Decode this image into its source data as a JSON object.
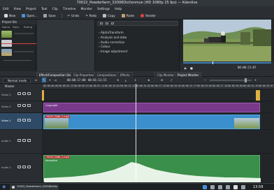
{
  "window": {
    "title": "70022_Powderfarm_32006Dictionmun (HD 1080p 25 fps) — Kdenlive"
  },
  "menu": [
    "Edit",
    "View",
    "Project",
    "Tool",
    "Clip",
    "Timeline",
    "Monitor",
    "Settings",
    "Help"
  ],
  "toolbar": {
    "new": "New",
    "open": "Open...",
    "save": "Save",
    "undo": "Undo",
    "redo": "Redo",
    "copy": "Copy",
    "paste": "Paste",
    "render": "Render"
  },
  "library": {
    "bin": "Project Bin",
    "col_name": "Name",
    "col_date": "Date",
    "col_rating": "Rating"
  },
  "effects": {
    "items": [
      "AlphaTransform",
      "Analysis and data",
      "Audio correction",
      "Colour",
      "Image adjustment"
    ]
  },
  "monitor": {
    "timecode": "00:00:21:07"
  },
  "tabs": [
    "Effect/Composition Stack",
    "Clip Properties",
    "Compositions",
    "Effects",
    "Clip Monitor",
    "Project Monitor"
  ],
  "timeline": {
    "mode": "Normal mode",
    "timecode": "00:00:17:00",
    "duration": "00:01:13:15",
    "master": "Master",
    "ruler": [
      "00:00:00:00",
      "00:00:02:13",
      "00:00:05:01",
      "00:00:07:14",
      "00:00:10:02",
      "00:00:12:15",
      "00:00:15:03",
      "00:00:17:16",
      "00:00:20:04",
      "00:00:22:17",
      "00:00:25:05",
      "00:00:27:18",
      "00:00:30:06",
      "00:00:32:19",
      "00:00:35:07"
    ],
    "tracks": [
      {
        "name": "Video 3"
      },
      {
        "name": "Video 2"
      },
      {
        "name": "Video 1"
      },
      {
        "name": "Audio 1"
      },
      {
        "name": "Audio 2"
      }
    ],
    "clips": {
      "title": "Copyright",
      "video": "70022_Rdfd_1.mp4",
      "audio": "70022_Rdfd_1.mp4",
      "audio_sub": "Normalise"
    }
  },
  "status": {
    "time": "13:59"
  }
}
